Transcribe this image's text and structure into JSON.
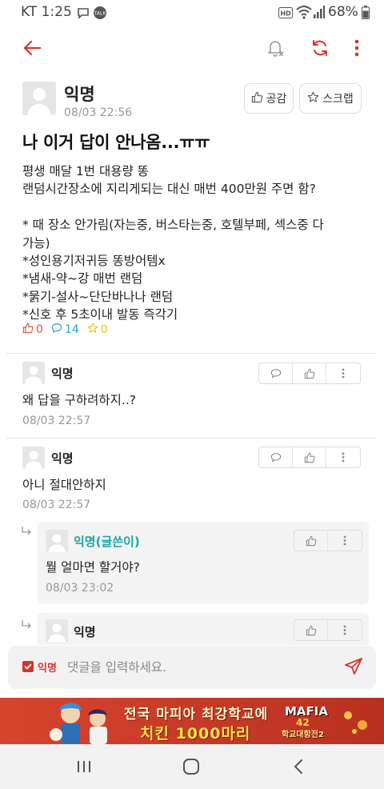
{
  "status_bar": {
    "carrier": "KT 1:25",
    "battery": "68%",
    "icons": [
      "chat-bubble-icon",
      "talk-icon",
      "hd-icon",
      "wifi-icon",
      "signal-icon",
      "battery-icon"
    ]
  },
  "app_bar": {
    "icons": [
      "back-arrow-icon",
      "notification-off-icon",
      "refresh-icon",
      "more-vertical-icon"
    ]
  },
  "post": {
    "author": "익명",
    "date": "08/03 22:56",
    "like_button": "공감",
    "scrap_button": "스크랩",
    "title": "나 이거 답이 안나옴...ㅠㅠ",
    "body_lines": [
      "평생 매달 1번 대용량 똥",
      "랜덤시간장소에 지리게되는 대신 매번 400만원 주면 함?",
      "",
      "* 때 장소 안가림(자는중, 버스타는중, 호텔부페, 섹스중 다",
      "가능)",
      "*성인용기저귀등 똥방어템x",
      "*냄새-약~강 매번 랜덤",
      "*묽기-설사~단단바나나 랜덤",
      "*신호 후 5초이내 발동 즉각기"
    ],
    "stats": {
      "likes": "0",
      "comments": "14",
      "scraps": "0"
    }
  },
  "comments": [
    {
      "author": "익명",
      "text": "왜 답을 구하려하지..?",
      "date": "08/03 22:57"
    },
    {
      "author": "익명",
      "text": "아니 절대안하지",
      "date": "08/03 22:57"
    }
  ],
  "replies": [
    {
      "author": "익명(글쓴이)",
      "text": "뭘 얼마면 할거야?",
      "date": "08/03 23:02"
    },
    {
      "author": "익명"
    }
  ],
  "comment_input": {
    "anon_label": "익명",
    "placeholder": "댓글을 입력하세요."
  },
  "ad": {
    "line1": "전국 마피아 최강학교에",
    "line2": "치킨 1000마리",
    "logo_line1": "MAFIA",
    "logo_line2": "42",
    "logo_line3": "학교대항전2"
  },
  "colors": {
    "accent": "#d9342b",
    "author_op": "#1aa4a8",
    "like": "#e0523f",
    "comment": "#2aa1d8",
    "scrap": "#e8c417"
  }
}
